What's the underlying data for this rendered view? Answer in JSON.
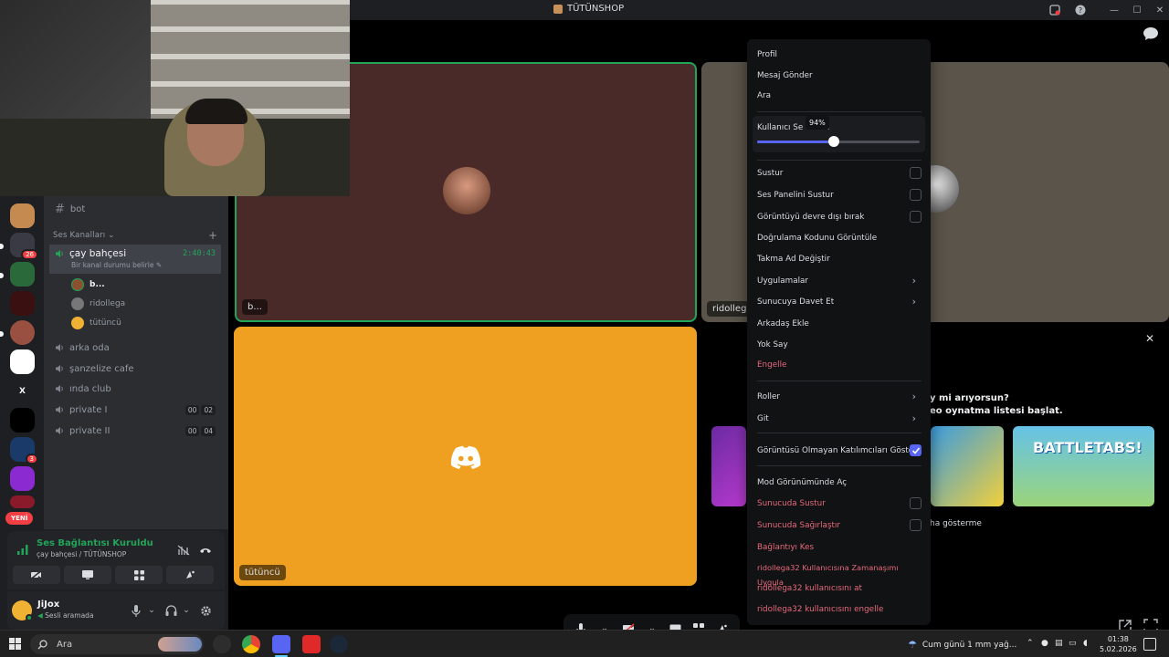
{
  "window": {
    "title": "TÜTÜNSHOP"
  },
  "server_badges": {
    "s1": "26",
    "s2": "3",
    "x_label": "X",
    "new_label": "YENİ"
  },
  "channels": {
    "text_channel": "bot",
    "category": "Ses Kanalları",
    "active_voice": {
      "name": "çay bahçesi",
      "timer": "2:40:43",
      "status": "Bir kanal durumu belirle"
    },
    "voice_users": [
      "b...",
      "ridollega",
      "tütüncü"
    ],
    "voice_channels": [
      {
        "name": "arka oda"
      },
      {
        "name": "şanzelize cafe"
      },
      {
        "name": "ında club"
      },
      {
        "name": "private I",
        "count_a": "00",
        "count_b": "02"
      },
      {
        "name": "private II",
        "count_a": "00",
        "count_b": "04"
      }
    ]
  },
  "voice_panel": {
    "title": "Ses Bağlantısı Kuruldu",
    "subtitle": "çay bahçesi / TÜTÜNSHOP"
  },
  "user": {
    "name": "JiJox",
    "status": "Sesli aramada"
  },
  "tiles": {
    "t1_label": "b...",
    "t2_label": "ridollega",
    "t3_label": "tütüncü"
  },
  "activity": {
    "question_line1": "y mi arıyorsun?",
    "question_line2": "eo oynatma listesi başlat.",
    "more": "ha gösterme",
    "game3": "BATTLETABS!"
  },
  "context_menu": {
    "items_top": [
      "Profil",
      "Mesaj Gönder",
      "Ara"
    ],
    "volume": {
      "label": "Kullanıcı Ses Seviyesi",
      "visible_label_a": "Kullanıcı Se",
      "visible_label_b": "si",
      "value_percent": 94,
      "tooltip": "94%"
    },
    "checks": [
      {
        "label": "Sustur",
        "checked": false
      },
      {
        "label": "Ses Panelini Sustur",
        "checked": false
      },
      {
        "label": "Görüntüyü devre dışı bırak",
        "checked": false
      }
    ],
    "items_mid": [
      "Doğrulama Kodunu Görüntüle",
      "Takma Ad Değiştir"
    ],
    "submenus_1": [
      "Uygulamalar",
      "Sunucuya Davet Et"
    ],
    "items_mid2": [
      "Arkadaş Ekle",
      "Yok Say"
    ],
    "block": "Engelle",
    "submenus_2": [
      "Roller",
      "Git"
    ],
    "show_no_video": {
      "label": "Görüntüsü Olmayan Katılımcıları Göster",
      "checked": true
    },
    "mod_view": "Mod Görünümünde Aç",
    "server_checks": [
      {
        "label": "Sunucuda Sustur",
        "checked": false
      },
      {
        "label": "Sunucuda Sağırlaştır",
        "checked": false
      }
    ],
    "danger": [
      "Bağlantıyı Kes",
      "ridollega32 Kullanıcısına Zamanaşımı Uygula",
      "ridollega32 kullanıcısını at",
      "ridollega32 kullanıcısını engelle"
    ]
  },
  "taskbar": {
    "search": "Ara",
    "weather": "Cum günü 1 mm yağ...",
    "time": "01:38",
    "date": "5.02.2026"
  },
  "colors": {
    "accent": "#5865f2",
    "online": "#23a559",
    "danger": "#e66a7b",
    "tile_brown": "#4a2a28",
    "tile_orange": "#f0a020"
  }
}
